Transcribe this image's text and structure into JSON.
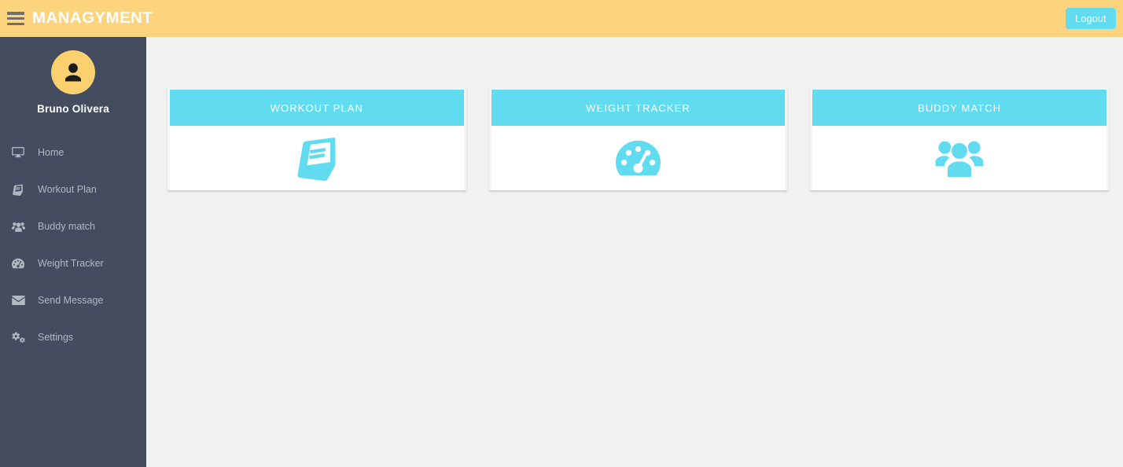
{
  "topbar": {
    "menu_icon": "hamburger-icon",
    "app_title": "MANAGYMENT",
    "logout_label": "Logout",
    "bg_color": "#fcd47d",
    "title_color": "#ffffff",
    "logout_color": "#60dbef"
  },
  "sidebar": {
    "bg_color": "#444c60",
    "avatar_icon": "user-silhouette-icon",
    "avatar_bg_color": "#fbd06f",
    "user_name": "Bruno Olivera",
    "items": [
      {
        "label": "Home",
        "icon": "desktop-icon"
      },
      {
        "label": "Workout Plan",
        "icon": "book-icon"
      },
      {
        "label": "Buddy match",
        "icon": "users-icon"
      },
      {
        "label": "Weight Tracker",
        "icon": "tachometer-icon"
      },
      {
        "label": "Send Message",
        "icon": "envelope-icon"
      },
      {
        "label": "Settings",
        "icon": "cogs-icon"
      }
    ]
  },
  "main": {
    "bg_color": "#f1f1f1",
    "accent_color": "#60dbef",
    "cards": [
      {
        "title": "WORKOUT PLAN",
        "icon": "book-icon"
      },
      {
        "title": "WEIGHT TRACKER",
        "icon": "tachometer-icon"
      },
      {
        "title": "BUDDY MATCH",
        "icon": "users-icon"
      }
    ]
  }
}
